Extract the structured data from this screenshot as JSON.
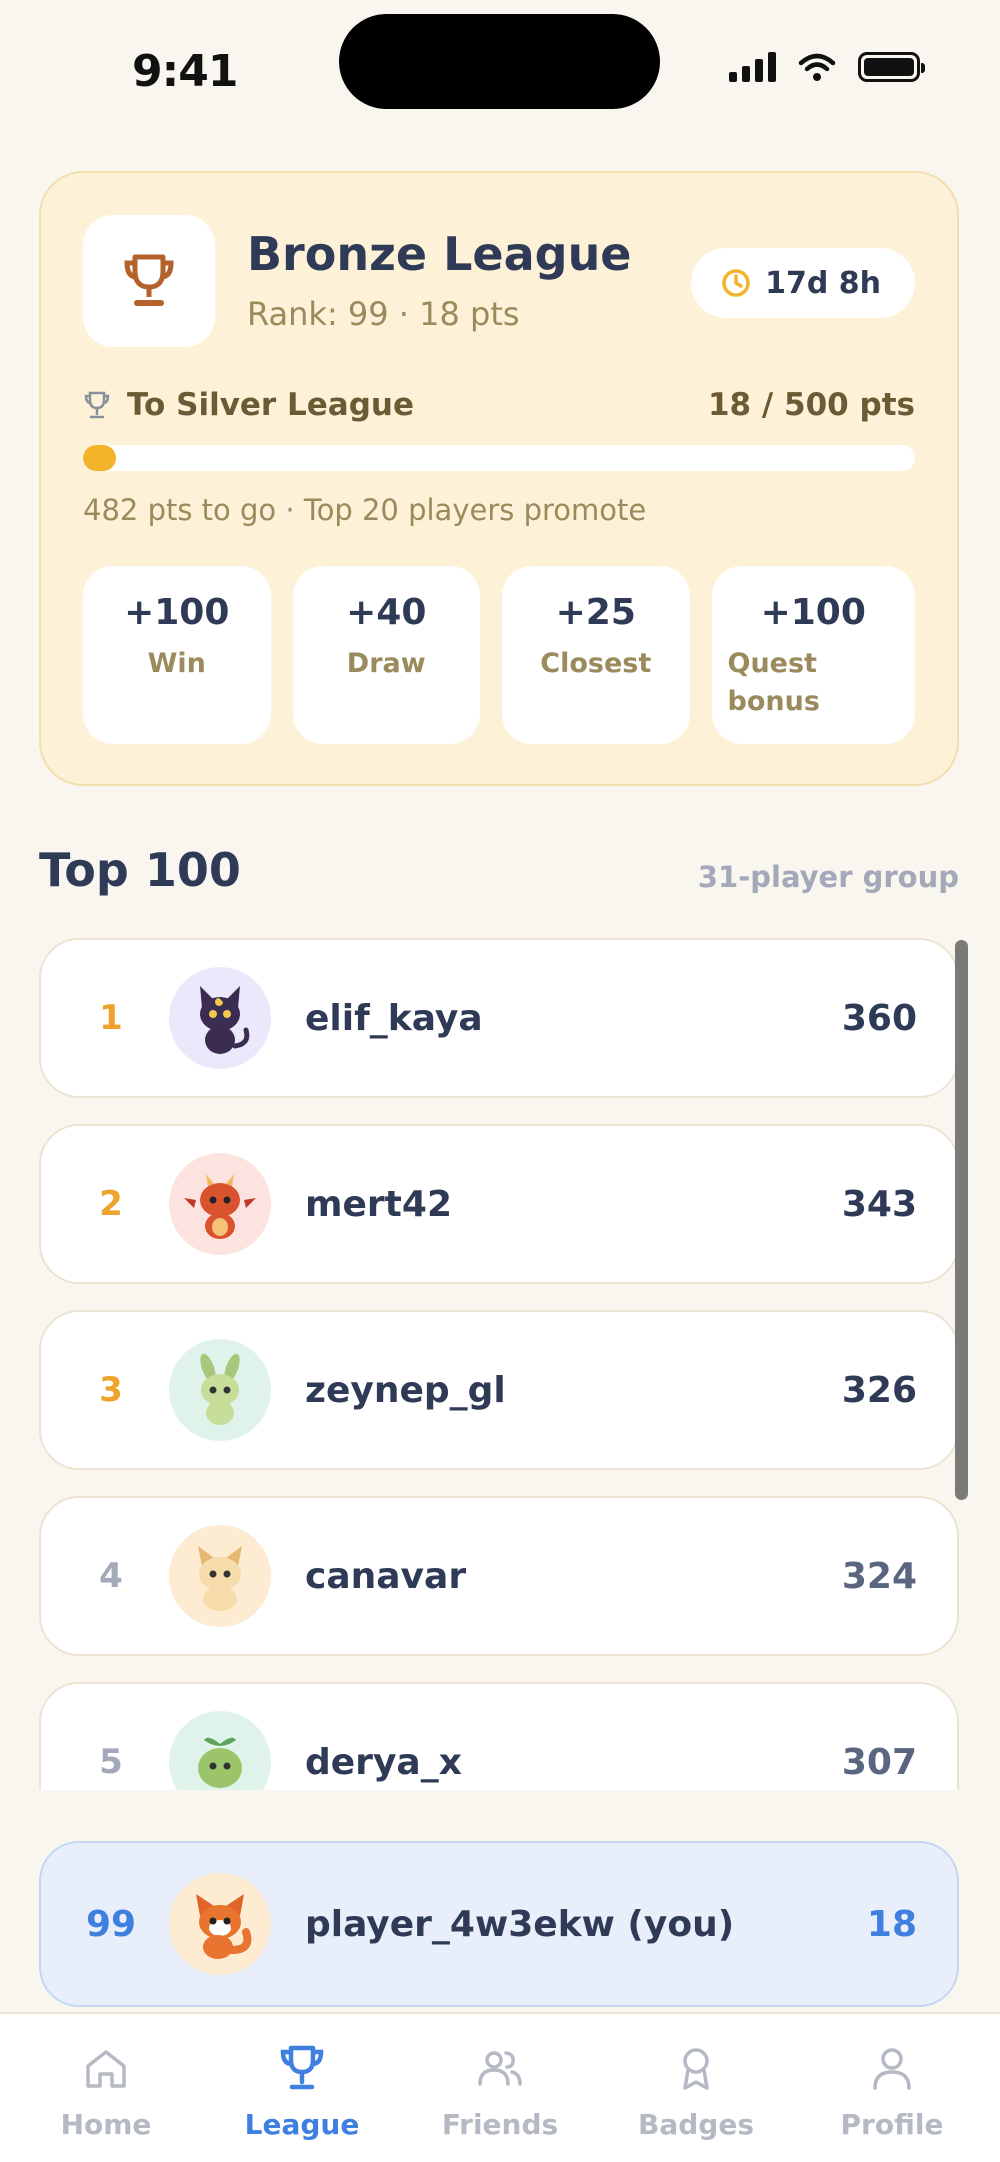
{
  "status_bar": {
    "time": "9:41"
  },
  "league": {
    "title": "Bronze League",
    "subtitle": "Rank: 99 · 18 pts",
    "timer": "17d 8h",
    "progress_label": "To Silver League",
    "progress_value": "18 / 500 pts",
    "progress_fraction": 0.036,
    "progress_note": "482 pts to go · Top 20 players promote",
    "points": [
      {
        "value": "+100",
        "label": "Win"
      },
      {
        "value": "+40",
        "label": "Draw"
      },
      {
        "value": "+25",
        "label": "Closest"
      },
      {
        "value": "+100",
        "label": "Quest bonus"
      }
    ]
  },
  "leaderboard": {
    "title": "Top 100",
    "group_info": "31-player group",
    "rows": [
      {
        "rank": "1",
        "name": "elif_kaya",
        "score": "360",
        "avatar": "black-cat-avatar"
      },
      {
        "rank": "2",
        "name": "mert42",
        "score": "343",
        "avatar": "red-dragon-avatar"
      },
      {
        "rank": "3",
        "name": "zeynep_gl",
        "score": "326",
        "avatar": "green-bunny-avatar"
      },
      {
        "rank": "4",
        "name": "canavar",
        "score": "324",
        "avatar": "cream-fox-avatar"
      },
      {
        "rank": "5",
        "name": "derya_x",
        "score": "307",
        "avatar": "sprout-blob-avatar"
      }
    ],
    "you": {
      "rank": "99",
      "name": "player_4w3ekw (you)",
      "score": "18",
      "avatar": "red-fox-avatar"
    }
  },
  "tabs": [
    {
      "label": "Home",
      "icon": "home-icon"
    },
    {
      "label": "League",
      "icon": "trophy-icon",
      "active": true
    },
    {
      "label": "Friends",
      "icon": "friends-icon"
    },
    {
      "label": "Badges",
      "icon": "badge-icon"
    },
    {
      "label": "Profile",
      "icon": "profile-icon"
    }
  ],
  "colors": {
    "accent": "#3f7fe0",
    "gold_rank": "#eea32c",
    "progress": "#f2b42a",
    "card_bg": "#fdf1d8"
  }
}
